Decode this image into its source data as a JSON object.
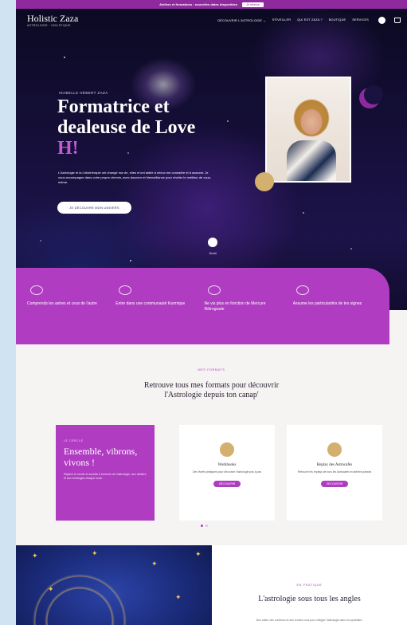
{
  "announcement": {
    "message": "Ateliers et formations : nouvelles dates disponibles",
    "button": "Je réserve"
  },
  "nav": {
    "logo": "Holistic Zaza",
    "logo_sub": "ASTROLOGIE · HOLISTIQUE",
    "links": [
      "DÉCOUVRIR L'ASTROLOGIE ⌄",
      "S'ÉVEILLER",
      "QUI EST ZAZA ?",
      "BOUTIQUE",
      "SERVICES"
    ],
    "icons": [
      "user-icon",
      "cart-icon"
    ]
  },
  "hero": {
    "eyebrow": "ISABELLE HÉBERT ZAZA",
    "headline_line1": "Formatrice et",
    "headline_line2": "dealeuse de Love",
    "headline_accent": "H!",
    "intro": "L'Astrologie et la Lithothérapie ont changé ma vie, elles m'ont aidée à mieux me connaître et à avancer. Je vous accompagne dans votre propre chemin, avec douceur et bienveillance pour révéler le meilleur de vous-même.",
    "cta": "JE DÉCOUVRE MON UNIVERS",
    "scroll_label": "Scroll",
    "colors": {
      "accent": "#c25ad6",
      "brand": "#b03cc2",
      "gold": "#d3b06d"
    }
  },
  "benefits": [
    {
      "icon": "planet-icon",
      "text": "Comprends les astres et ceux de l'autre"
    },
    {
      "icon": "planet-icon",
      "text": "Entre dans une communauté Karmique"
    },
    {
      "icon": "planet-icon",
      "text": "Ne vis plus en fonction de Mercure Rétrograde"
    },
    {
      "icon": "planet-icon",
      "text": "Assume les particularités de tes signes"
    }
  ],
  "formats": {
    "eyebrow": "MES FORMATS",
    "title_line1": "Retrouve tous mes formats pour découvrir",
    "title_line2": "l'Astrologie depuis ton canap'",
    "feature": {
      "eyebrow": "LE CERCLE",
      "title": "Ensemble, vibrons, vivons !",
      "desc": "Rejoins le cercle et accède à l'univers de l'astrologie, aux ateliers et aux échanges chaque mois."
    },
    "cards": [
      {
        "name": "Workbooks",
        "desc": "Des livrets pratiques pour découvrir l'astrologie pas à pas",
        "button": "DÉCOUVRIR"
      },
      {
        "name": "Replay des Astrocafés",
        "desc": "Retrouve les replays de tous les Astrocafés et ateliers passés",
        "button": "DÉCOUVRIR"
      }
    ]
  },
  "angles": {
    "eyebrow": "EN PRATIQUE",
    "title": "L'astrologie sous tous les angles",
    "desc": "Des outils, des contenus et des rendez-vous pour intégrer l'astrologie dans ton quotidien."
  }
}
